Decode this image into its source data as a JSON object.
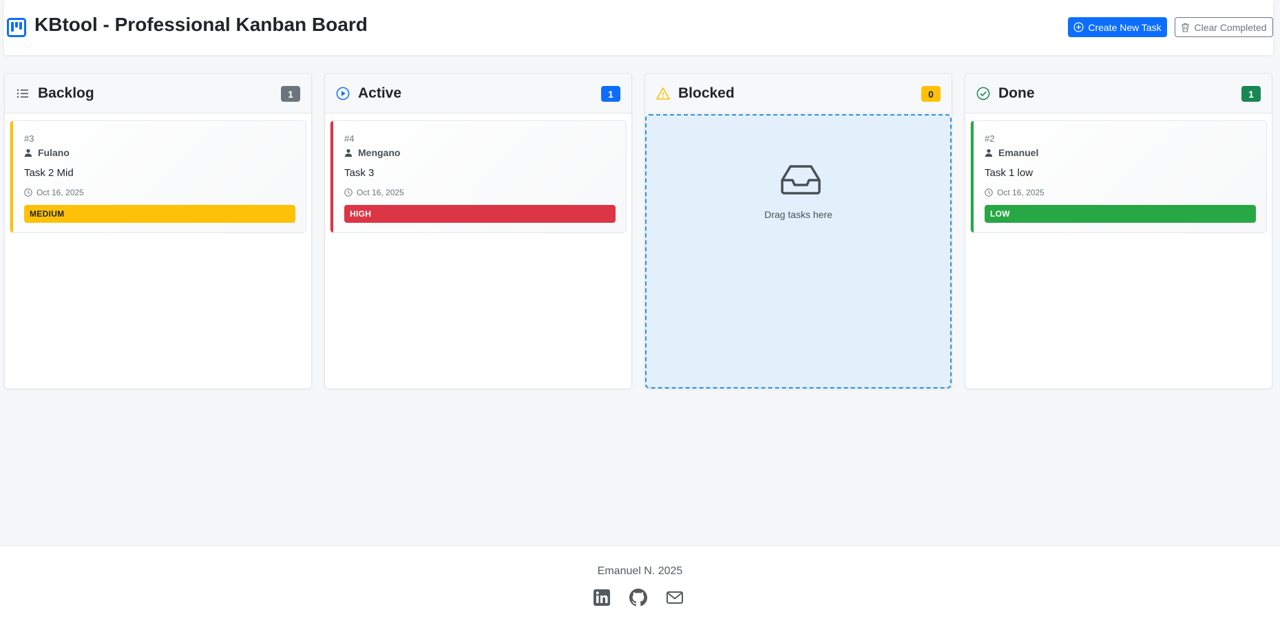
{
  "header": {
    "title": "KBtool - Professional Kanban Board",
    "create_label": "Create New Task",
    "clear_label": "Clear Completed"
  },
  "colors": {
    "primary": "#0d6efd",
    "secondary": "#6c757d",
    "warning": "#ffc107",
    "danger": "#dc3545",
    "success": "#28a745",
    "done_badge": "#198754",
    "drop_bg": "#e3f0fb",
    "drop_border": "#2e8fe0"
  },
  "columns": [
    {
      "title": "Backlog",
      "count": "1",
      "icon": "list-icon",
      "task": {
        "id": "#3",
        "user": "Fulano",
        "title": "Task 2 Mid",
        "date": "Oct 16, 2025",
        "priority": "MEDIUM"
      }
    },
    {
      "title": "Active",
      "count": "1",
      "icon": "play-circle-icon",
      "task": {
        "id": "#4",
        "user": "Mengano",
        "title": "Task 3",
        "date": "Oct 16, 2025",
        "priority": "HIGH"
      }
    },
    {
      "title": "Blocked",
      "count": "0",
      "icon": "warning-icon",
      "empty_text": "Drag tasks here"
    },
    {
      "title": "Done",
      "count": "1",
      "icon": "check-circle-icon",
      "task": {
        "id": "#2",
        "user": "Emanuel",
        "title": "Task 1 low",
        "date": "Oct 16, 2025",
        "priority": "LOW"
      }
    }
  ],
  "footer": {
    "text": "Emanuel N. 2025",
    "links": [
      "linkedin-icon",
      "github-icon",
      "mail-icon"
    ]
  }
}
